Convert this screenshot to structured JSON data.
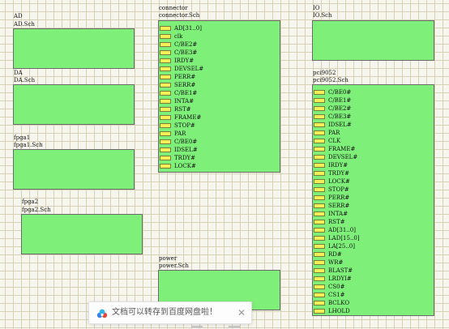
{
  "sheets": {
    "ad": {
      "name": "AD",
      "file": "AD.Sch"
    },
    "da": {
      "name": "DA",
      "file": "DA.Sch"
    },
    "fpga1": {
      "name": "fpga1",
      "file": "fpga1.Sch"
    },
    "fpga2": {
      "name": "fpga2",
      "file": "fpga2.Sch"
    },
    "connector": {
      "name": "connector",
      "file": "connector.Sch",
      "pins": [
        "AD[31..0]",
        "clk",
        "C/BE2#",
        "C/BE3#",
        "IRDY#",
        "DEVSEL#",
        "PERR#",
        "SERR#",
        "C/BE1#",
        "INTA#",
        "RST#",
        "FRAME#",
        "STOP#",
        "PAR",
        "C/BE0#",
        "IDSEL#",
        "TRDY#",
        "LOCK#"
      ]
    },
    "power": {
      "name": "power",
      "file": "power.Sch"
    },
    "io": {
      "name": "IO",
      "file": "IO.Sch"
    },
    "pci9052": {
      "name": "pci9052",
      "file": "pci9052.Sch",
      "pins": [
        "C/BE0#",
        "C/BE1#",
        "C/BE2#",
        "C/BE3#",
        "IDSEL#",
        "PAR",
        "CLK",
        "FRAME#",
        "DEVSEL#",
        "IRDY#",
        "TRDY#",
        "LOCK#",
        "STOP#",
        "PERR#",
        "SERR#",
        "INTA#",
        "RST#",
        "AD[31..0]",
        "LAD[15..0]",
        "LA[25..0]",
        "RD#",
        "WR#",
        "BLAST#",
        "LRDYI#",
        "CS0#",
        "CS1#",
        "BCLKO",
        "LHOLD"
      ]
    }
  },
  "toast": {
    "message": "文档可以转存到百度网盘啦！",
    "close": "✕",
    "icon": "cloud-icon"
  },
  "colors": {
    "sheet_fill": "#7ef07a",
    "port_fill": "#f4ef56",
    "grid": "#d6d1b4",
    "background": "#f7f6ee"
  }
}
